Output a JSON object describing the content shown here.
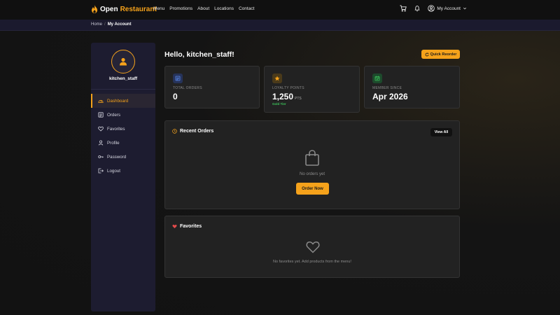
{
  "header": {
    "brand_part1": "Open",
    "brand_part2": "Restaurant",
    "nav": [
      "Menu",
      "Promotions",
      "About",
      "Locations",
      "Contact"
    ],
    "account_label": "My Account"
  },
  "breadcrumb": {
    "home": "Home",
    "separator": "/",
    "current": "My Account"
  },
  "sidebar": {
    "username": "kitchen_staff",
    "items": [
      {
        "label": "Dashboard",
        "icon": "dashboard-icon",
        "active": true
      },
      {
        "label": "Orders",
        "icon": "orders-icon",
        "active": false
      },
      {
        "label": "Favorites",
        "icon": "heart-icon",
        "active": false
      },
      {
        "label": "Profile",
        "icon": "user-icon",
        "active": false
      },
      {
        "label": "Password",
        "icon": "key-icon",
        "active": false
      },
      {
        "label": "Logout",
        "icon": "logout-icon",
        "active": false
      }
    ]
  },
  "main": {
    "greeting": "Hello, kitchen_staff!",
    "quick_reorder_label": "Quick Reorder",
    "stats": {
      "total_orders": {
        "label": "TOTAL ORDERS",
        "value": "0"
      },
      "loyalty": {
        "label": "LOYALTY POINTS",
        "value": "1,250",
        "unit": "PTS",
        "tier": "Gold Tier"
      },
      "member_since": {
        "label": "MEMBER SINCE",
        "value": "Apr 2026"
      }
    },
    "recent_orders": {
      "title": "Recent Orders",
      "view_all_label": "View All",
      "empty_text": "No orders yet",
      "order_now_label": "Order Now"
    },
    "favorites": {
      "title": "Favorites",
      "empty_text": "No favorites yet. Add products from the menu!"
    }
  },
  "colors": {
    "accent": "#f5a21b",
    "sidebar_bg": "#1d1c30",
    "card_bg": "#222222",
    "tier_green": "#3cc25a"
  }
}
